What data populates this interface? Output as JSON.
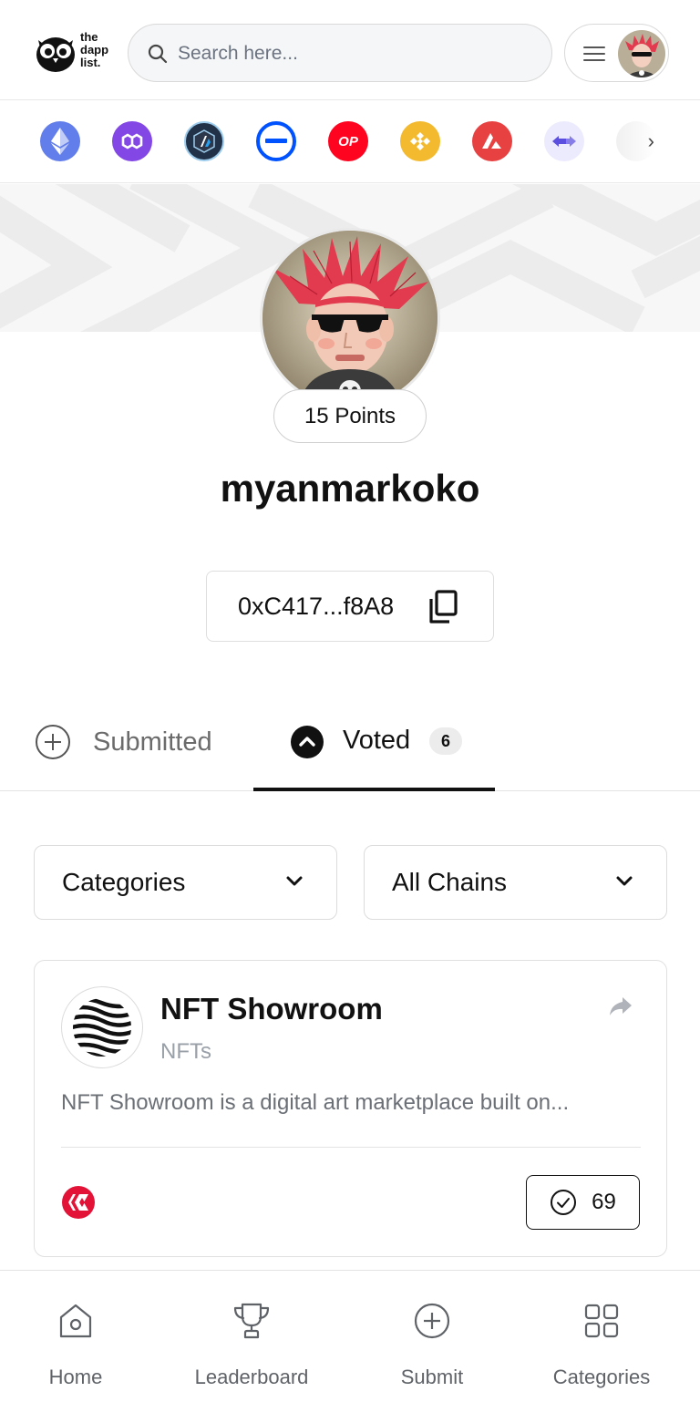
{
  "header": {
    "logo_text": [
      "the",
      "dapp",
      "list."
    ],
    "search_placeholder": "Search here..."
  },
  "chains": [
    {
      "name": "ethereum-chain-icon",
      "color": "#627eea"
    },
    {
      "name": "polygon-chain-icon",
      "color": "#8247e5"
    },
    {
      "name": "arbitrum-chain-icon",
      "color": "#213147"
    },
    {
      "name": "base-chain-icon",
      "color": "#0052ff"
    },
    {
      "name": "optimism-chain-icon",
      "color": "#ff0420",
      "label": "OP"
    },
    {
      "name": "bnb-chain-icon",
      "color": "#f3ba2f"
    },
    {
      "name": "avalanche-chain-icon",
      "color": "#e84142"
    },
    {
      "name": "bridge-chain-icon",
      "color": "#ecebfd"
    }
  ],
  "profile": {
    "points": "15 Points",
    "username": "myanmarkoko",
    "address": "0xC417...f8A8"
  },
  "tabs": {
    "submitted_label": "Submitted",
    "voted_label": "Voted",
    "voted_count": "6"
  },
  "filters": {
    "categories_label": "Categories",
    "chains_label": "All Chains"
  },
  "card": {
    "name": "NFT Showroom",
    "category": "NFTs",
    "description": "NFT Showroom is a digital art marketplace built on...",
    "votes": "69",
    "chain_color": "#e31337"
  },
  "bottom_nav": {
    "home": "Home",
    "leaderboard": "Leaderboard",
    "submit": "Submit",
    "categories": "Categories"
  }
}
